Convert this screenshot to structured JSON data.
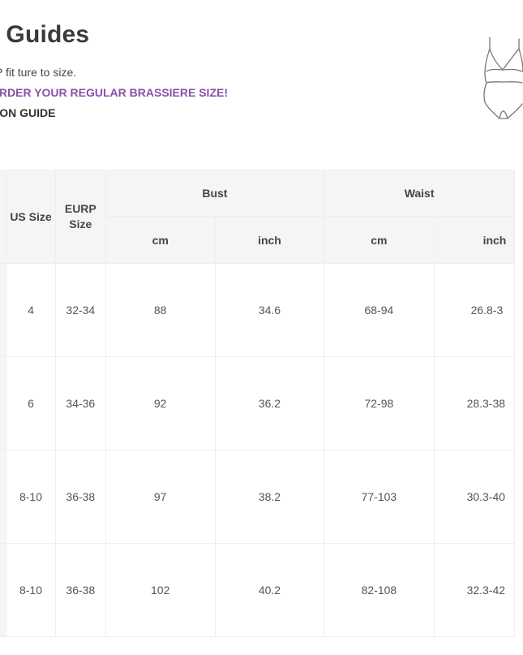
{
  "page": {
    "title": "e Guides",
    "line1": "P fit ture to size.",
    "line2": "ORDER YOUR REGULAR BRASSIERE SIZE!",
    "line3": "SION GUIDE",
    "illustration_icon": "bodysuit-outline-icon"
  },
  "colors": {
    "accent_purple": "#8a4fa8",
    "header_bg": "#f5f5f5",
    "border": "#eeeeee",
    "text": "#555555"
  },
  "table": {
    "headers": {
      "us_size": "US Size",
      "eurp_size": "EURP Size",
      "bust": "Bust",
      "waist": "Waist",
      "bust_cm": "cm",
      "bust_inch": "inch",
      "waist_cm": "cm",
      "waist_inch": "inch"
    },
    "rows": [
      {
        "us": "4",
        "eurp": "32-34",
        "bust_cm": "88",
        "bust_inch": "34.6",
        "waist_cm": "68-94",
        "waist_inch": "26.8-3"
      },
      {
        "us": "6",
        "eurp": "34-36",
        "bust_cm": "92",
        "bust_inch": "36.2",
        "waist_cm": "72-98",
        "waist_inch": "28.3-38"
      },
      {
        "us": "8-10",
        "eurp": "36-38",
        "bust_cm": "97",
        "bust_inch": "38.2",
        "waist_cm": "77-103",
        "waist_inch": "30.3-40"
      },
      {
        "us": "8-10",
        "eurp": "36-38",
        "bust_cm": "102",
        "bust_inch": "40.2",
        "waist_cm": "82-108",
        "waist_inch": "32.3-42"
      }
    ]
  }
}
